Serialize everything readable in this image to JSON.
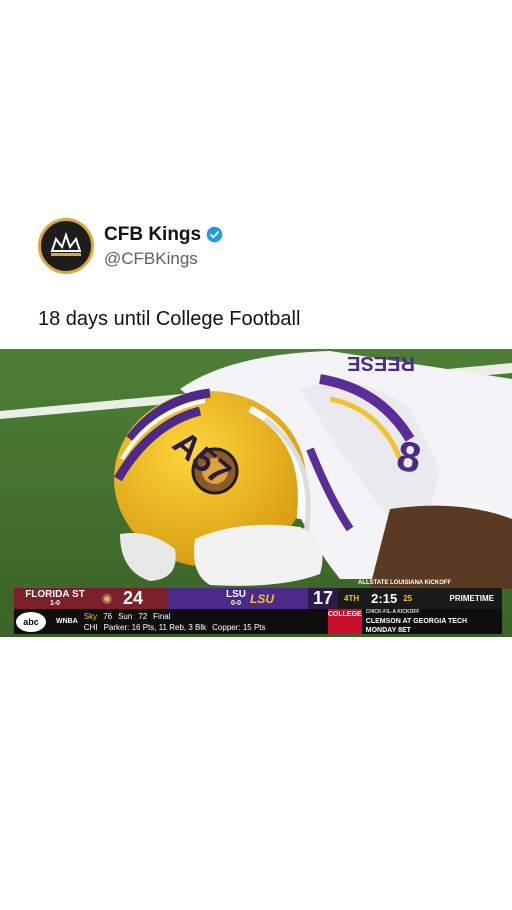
{
  "tweet": {
    "display_name": "CFB Kings",
    "handle": "@CFBKings",
    "text": "18 days until College Football",
    "verified": true
  },
  "media": {
    "helmet_text": "A57",
    "jersey_number": "8",
    "scorebug": {
      "title": "ALLSTATE LOUISIANA KICKOFF",
      "team1": "FLORIDA ST",
      "team1_record": "1-0",
      "team1_score": "24",
      "team2": "LSU",
      "team2_record": "0-0",
      "team2_logo": "LSU",
      "team2_score": "17",
      "period": "4TH",
      "clock": "2:15",
      "play_clock": "25",
      "network_brand": "PRIMETIME",
      "network": "abc",
      "ticker_league": "WNBA",
      "ticker_team1": "Sky",
      "ticker_team1_score": "76",
      "ticker_team2": "Sun",
      "ticker_team2_score": "72",
      "ticker_status": "Final",
      "ticker_line2_a": "CHI",
      "ticker_line2_b": "Parker: 16 Pts, 11 Reb, 3 Blk",
      "ticker_line2_c": "Copper: 15 Pts",
      "promo_brand": "COLLEGE",
      "promo_kicker": "CHICK-FIL-A KICKOFF",
      "promo_matchup": "CLEMSON AT GEORGIA TECH",
      "promo_time": "MONDAY 8ET"
    }
  },
  "colors": {
    "brand_gold": "#d9a93a",
    "verified_blue": "#1d9bf0",
    "fsu_garnet": "#7a1f2b",
    "lsu_purple": "#4b2a8a",
    "lsu_gold": "#f2c230"
  }
}
